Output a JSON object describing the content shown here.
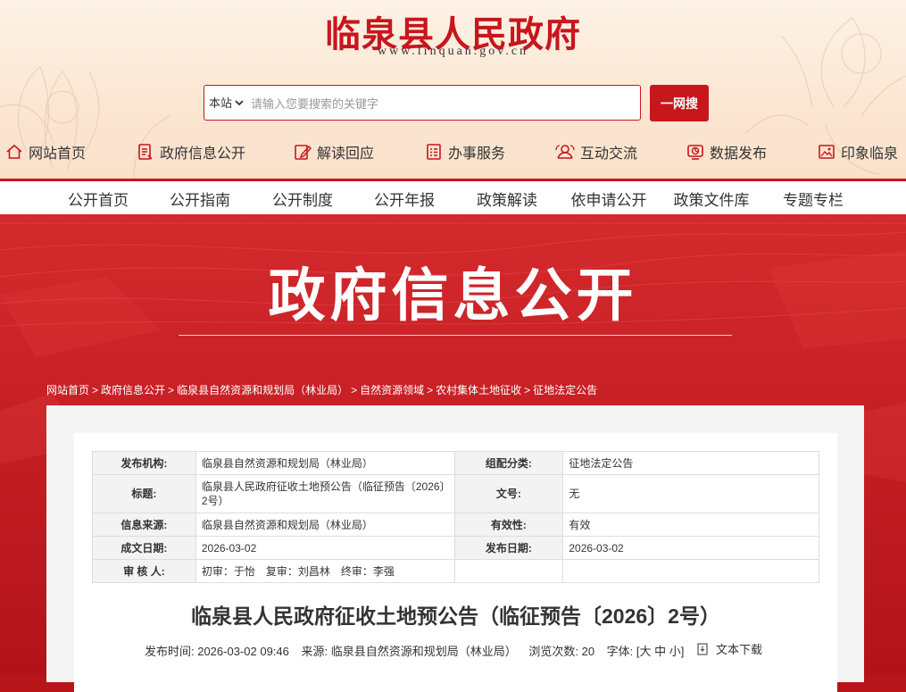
{
  "site": {
    "title": "临泉县人民政府",
    "url": "www.linquan.gov.cn"
  },
  "search": {
    "scope": "本站",
    "placeholder": "请输入您要搜索的关键字",
    "button": "一网搜"
  },
  "main_nav": [
    {
      "label": "网站首页",
      "icon": "home-icon"
    },
    {
      "label": "政府信息公开",
      "icon": "document-icon"
    },
    {
      "label": "解读回应",
      "icon": "edit-icon"
    },
    {
      "label": "办事服务",
      "icon": "list-icon"
    },
    {
      "label": "互动交流",
      "icon": "interaction-icon"
    },
    {
      "label": "数据发布",
      "icon": "chart-icon"
    },
    {
      "label": "印象临泉",
      "icon": "image-icon"
    }
  ],
  "sub_nav": [
    "公开首页",
    "公开指南",
    "公开制度",
    "公开年报",
    "政策解读",
    "依申请公开",
    "政策文件库",
    "专题专栏"
  ],
  "banner": {
    "title": "政府信息公开"
  },
  "breadcrumb": [
    "网站首页",
    "政府信息公开",
    "临泉县自然资源和规划局（林业局）",
    "自然资源领域",
    "农村集体土地征收",
    "征地法定公告"
  ],
  "meta": {
    "publisher_label": "发布机构:",
    "publisher": "临泉县自然资源和规划局（林业局）",
    "category_label": "组配分类:",
    "category": "征地法定公告",
    "title_label": "标题:",
    "title": "临泉县人民政府征收土地预公告（临征预告〔2026〕2号）",
    "doc_no_label": "文号:",
    "doc_no": "无",
    "source_label": "信息来源:",
    "source": "临泉县自然资源和规划局（林业局）",
    "validity_label": "有效性:",
    "validity": "有效",
    "created_label": "成文日期:",
    "created": "2026-03-02",
    "published_label": "发布日期:",
    "published": "2026-03-02",
    "reviewer_label": "审 核 人:",
    "reviewers": "初审：于怡　复审：刘昌林　终审：李强"
  },
  "article": {
    "title": "临泉县人民政府征收土地预公告（临征预告〔2026〕2号）",
    "publish_time": "发布时间:  2026-03-02 09:46",
    "source": "来源:  临泉县自然资源和规划局（林业局）",
    "views": "浏览次数:   20",
    "font_size": "字体:  [大 中 小]",
    "download": "文本下载"
  },
  "colors": {
    "brand_red": "#c8161d",
    "banner_red": "#b8151b",
    "header_bg": "#fdf2e6"
  }
}
